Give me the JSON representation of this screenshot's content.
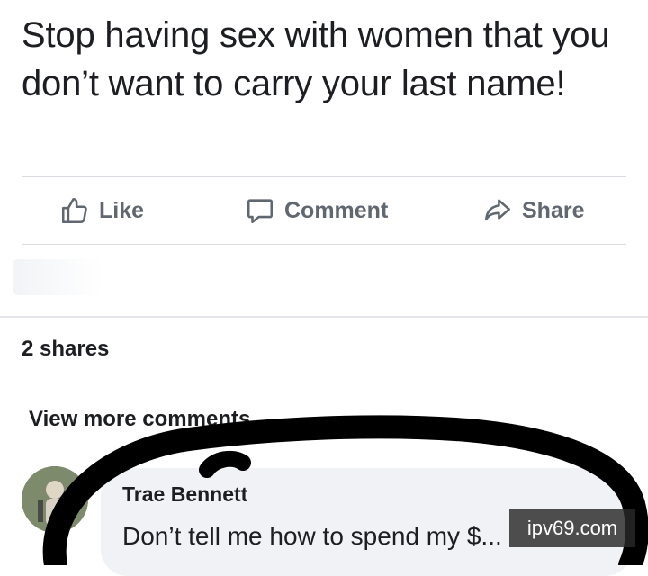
{
  "post": {
    "text": "Stop having sex with women that you don’t want to carry your last name!"
  },
  "actions": {
    "like_label": "Like",
    "like_icon": "thumbs-up-icon",
    "comment_label": "Comment",
    "comment_icon": "speech-bubble-icon",
    "share_label": "Share",
    "share_icon": "share-arrow-icon"
  },
  "stats": {
    "shares": "2 shares"
  },
  "comments": {
    "view_more": "View more comments",
    "items": [
      {
        "author": "Trae Bennett",
        "text": "Don’t tell me how to spend my $..."
      }
    ]
  },
  "watermark": {
    "text": "ipv69.com"
  },
  "colors": {
    "text": "#1c1e21",
    "muted": "#606770",
    "divider": "#dadde1",
    "bubble": "#f0f2f5",
    "scribble": "#000000"
  }
}
